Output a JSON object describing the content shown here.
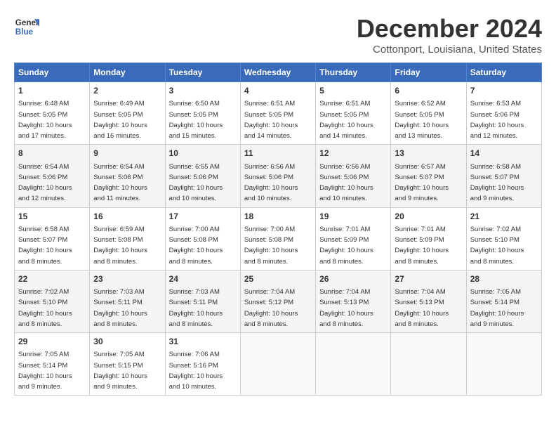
{
  "header": {
    "logo_line1": "General",
    "logo_line2": "Blue",
    "month": "December 2024",
    "location": "Cottonport, Louisiana, United States"
  },
  "weekdays": [
    "Sunday",
    "Monday",
    "Tuesday",
    "Wednesday",
    "Thursday",
    "Friday",
    "Saturday"
  ],
  "weeks": [
    [
      {
        "day": "1",
        "info": "Sunrise: 6:48 AM\nSunset: 5:05 PM\nDaylight: 10 hours\nand 17 minutes."
      },
      {
        "day": "2",
        "info": "Sunrise: 6:49 AM\nSunset: 5:05 PM\nDaylight: 10 hours\nand 16 minutes."
      },
      {
        "day": "3",
        "info": "Sunrise: 6:50 AM\nSunset: 5:05 PM\nDaylight: 10 hours\nand 15 minutes."
      },
      {
        "day": "4",
        "info": "Sunrise: 6:51 AM\nSunset: 5:05 PM\nDaylight: 10 hours\nand 14 minutes."
      },
      {
        "day": "5",
        "info": "Sunrise: 6:51 AM\nSunset: 5:05 PM\nDaylight: 10 hours\nand 14 minutes."
      },
      {
        "day": "6",
        "info": "Sunrise: 6:52 AM\nSunset: 5:05 PM\nDaylight: 10 hours\nand 13 minutes."
      },
      {
        "day": "7",
        "info": "Sunrise: 6:53 AM\nSunset: 5:06 PM\nDaylight: 10 hours\nand 12 minutes."
      }
    ],
    [
      {
        "day": "8",
        "info": "Sunrise: 6:54 AM\nSunset: 5:06 PM\nDaylight: 10 hours\nand 12 minutes."
      },
      {
        "day": "9",
        "info": "Sunrise: 6:54 AM\nSunset: 5:06 PM\nDaylight: 10 hours\nand 11 minutes."
      },
      {
        "day": "10",
        "info": "Sunrise: 6:55 AM\nSunset: 5:06 PM\nDaylight: 10 hours\nand 10 minutes."
      },
      {
        "day": "11",
        "info": "Sunrise: 6:56 AM\nSunset: 5:06 PM\nDaylight: 10 hours\nand 10 minutes."
      },
      {
        "day": "12",
        "info": "Sunrise: 6:56 AM\nSunset: 5:06 PM\nDaylight: 10 hours\nand 10 minutes."
      },
      {
        "day": "13",
        "info": "Sunrise: 6:57 AM\nSunset: 5:07 PM\nDaylight: 10 hours\nand 9 minutes."
      },
      {
        "day": "14",
        "info": "Sunrise: 6:58 AM\nSunset: 5:07 PM\nDaylight: 10 hours\nand 9 minutes."
      }
    ],
    [
      {
        "day": "15",
        "info": "Sunrise: 6:58 AM\nSunset: 5:07 PM\nDaylight: 10 hours\nand 8 minutes."
      },
      {
        "day": "16",
        "info": "Sunrise: 6:59 AM\nSunset: 5:08 PM\nDaylight: 10 hours\nand 8 minutes."
      },
      {
        "day": "17",
        "info": "Sunrise: 7:00 AM\nSunset: 5:08 PM\nDaylight: 10 hours\nand 8 minutes."
      },
      {
        "day": "18",
        "info": "Sunrise: 7:00 AM\nSunset: 5:08 PM\nDaylight: 10 hours\nand 8 minutes."
      },
      {
        "day": "19",
        "info": "Sunrise: 7:01 AM\nSunset: 5:09 PM\nDaylight: 10 hours\nand 8 minutes."
      },
      {
        "day": "20",
        "info": "Sunrise: 7:01 AM\nSunset: 5:09 PM\nDaylight: 10 hours\nand 8 minutes."
      },
      {
        "day": "21",
        "info": "Sunrise: 7:02 AM\nSunset: 5:10 PM\nDaylight: 10 hours\nand 8 minutes."
      }
    ],
    [
      {
        "day": "22",
        "info": "Sunrise: 7:02 AM\nSunset: 5:10 PM\nDaylight: 10 hours\nand 8 minutes."
      },
      {
        "day": "23",
        "info": "Sunrise: 7:03 AM\nSunset: 5:11 PM\nDaylight: 10 hours\nand 8 minutes."
      },
      {
        "day": "24",
        "info": "Sunrise: 7:03 AM\nSunset: 5:11 PM\nDaylight: 10 hours\nand 8 minutes."
      },
      {
        "day": "25",
        "info": "Sunrise: 7:04 AM\nSunset: 5:12 PM\nDaylight: 10 hours\nand 8 minutes."
      },
      {
        "day": "26",
        "info": "Sunrise: 7:04 AM\nSunset: 5:13 PM\nDaylight: 10 hours\nand 8 minutes."
      },
      {
        "day": "27",
        "info": "Sunrise: 7:04 AM\nSunset: 5:13 PM\nDaylight: 10 hours\nand 8 minutes."
      },
      {
        "day": "28",
        "info": "Sunrise: 7:05 AM\nSunset: 5:14 PM\nDaylight: 10 hours\nand 9 minutes."
      }
    ],
    [
      {
        "day": "29",
        "info": "Sunrise: 7:05 AM\nSunset: 5:14 PM\nDaylight: 10 hours\nand 9 minutes."
      },
      {
        "day": "30",
        "info": "Sunrise: 7:05 AM\nSunset: 5:15 PM\nDaylight: 10 hours\nand 9 minutes."
      },
      {
        "day": "31",
        "info": "Sunrise: 7:06 AM\nSunset: 5:16 PM\nDaylight: 10 hours\nand 10 minutes."
      },
      {
        "day": "",
        "info": ""
      },
      {
        "day": "",
        "info": ""
      },
      {
        "day": "",
        "info": ""
      },
      {
        "day": "",
        "info": ""
      }
    ]
  ]
}
